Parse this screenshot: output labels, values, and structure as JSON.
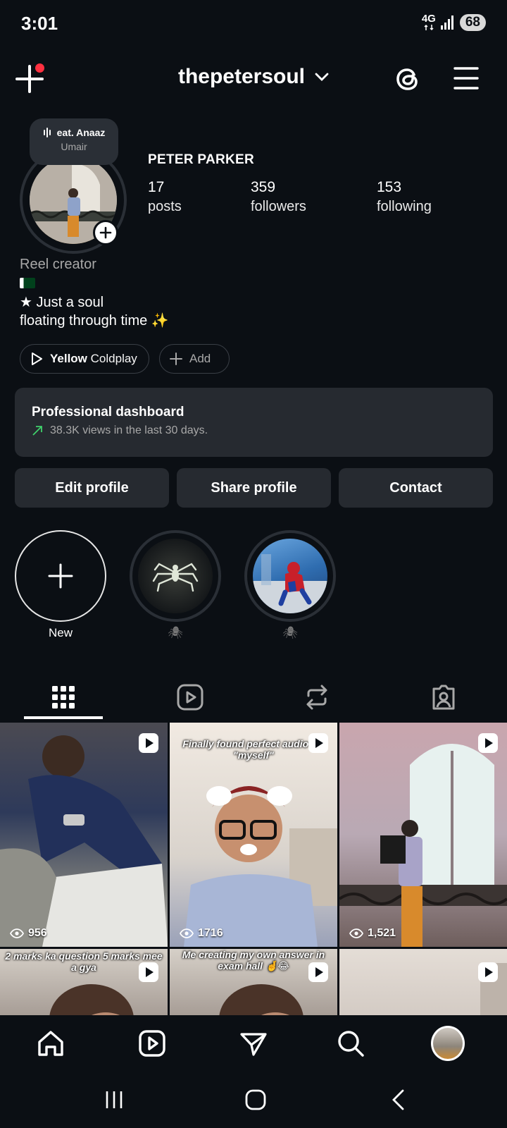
{
  "status_bar": {
    "time": "3:01",
    "network": "4G",
    "battery": "68"
  },
  "header": {
    "username": "thepetersoul"
  },
  "note": {
    "title": "eat. Anaaz",
    "subtitle": "Umair"
  },
  "profile": {
    "display_name": "PETER PARKER",
    "stats": [
      {
        "count": "17",
        "label": "posts"
      },
      {
        "count": "359",
        "label": "followers"
      },
      {
        "count": "153",
        "label": "following"
      }
    ],
    "bio": {
      "category": "Reel creator",
      "line1": "★ Just a soul",
      "line2": "floating through time ✨"
    },
    "music": {
      "song": "Yellow",
      "artist": "Coldplay"
    },
    "add_label": "Add"
  },
  "dashboard": {
    "title": "Professional dashboard",
    "subtitle": "38.3K views in the last 30 days."
  },
  "actions": {
    "edit": "Edit profile",
    "share": "Share profile",
    "contact": "Contact"
  },
  "highlights": [
    {
      "label": "New"
    },
    {
      "label": "🕷"
    },
    {
      "label": "🕷"
    }
  ],
  "grid": {
    "posts": [
      {
        "views": "956",
        "caption": ""
      },
      {
        "views": "1716",
        "caption": "Finally found perfect audio for \"myself\""
      },
      {
        "views": "1,521",
        "caption": ""
      },
      {
        "views": "",
        "caption": "2 marks ka question 5 marks mee a gya"
      },
      {
        "views": "",
        "caption": "Me creating my own answer in exam hall 🤞😂"
      },
      {
        "views": "",
        "caption": ""
      }
    ]
  },
  "colors": {
    "background": "#0b0f14",
    "card": "#262a30",
    "notification": "#ff3040",
    "trend_green": "#3fd16b"
  }
}
